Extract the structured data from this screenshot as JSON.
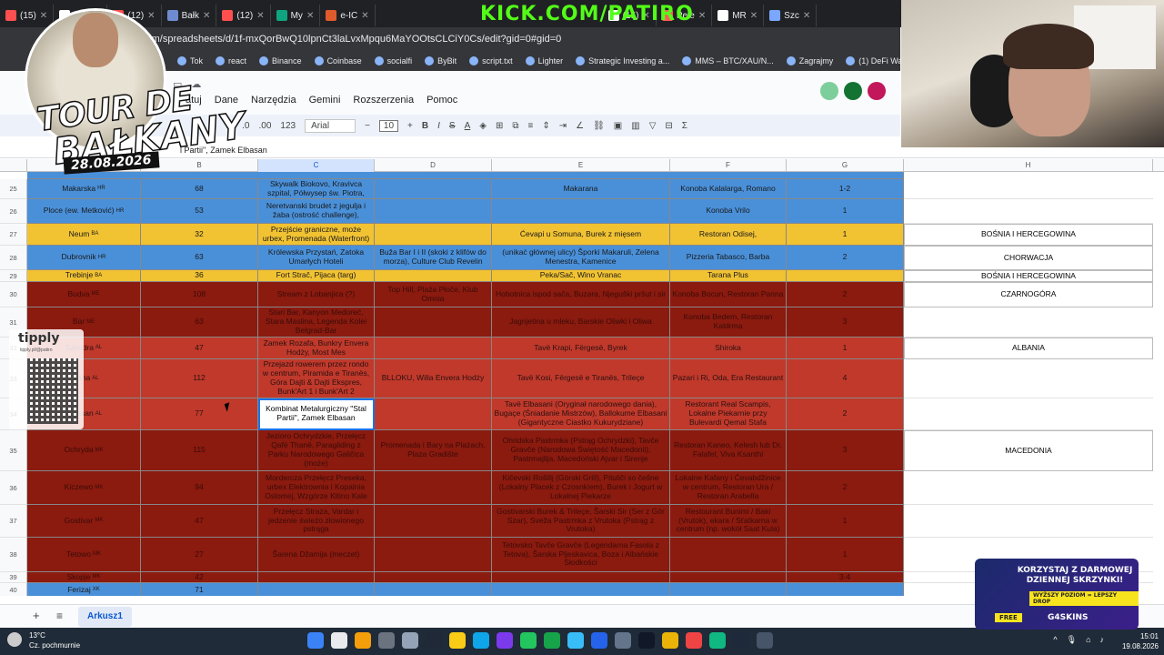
{
  "browser": {
    "tabs": [
      {
        "label": "(15)",
        "color": "#ff4f4f"
      },
      {
        "label": "(15)",
        "color": "#ffffff"
      },
      {
        "label": "(12)",
        "color": "#ff4f4f"
      },
      {
        "label": "Bałk",
        "color": "#6f8bd0"
      },
      {
        "label": "(12)",
        "color": "#ff4f4f"
      },
      {
        "label": "My",
        "color": "#10a37f"
      },
      {
        "label": "e-IC",
        "color": "#e05b2b"
      }
    ],
    "tabs_right": [
      {
        "label": "(15)",
        "color": "#ffffff"
      },
      {
        "label": "Pele",
        "color": "#ff5a5a"
      },
      {
        "label": "MR",
        "color": "#ffffff"
      },
      {
        "label": "Szc",
        "color": "#7aa7ff"
      }
    ],
    "kick_url": "KICK.COM/PATIRO",
    "url": "com/spreadsheets/d/1f-mxQorBwQ10lpnCt3laLvxMpqu6MaYOOtsCLCiY0Cs/edit?gid=0#gid=0",
    "bookmarks": [
      "Tok",
      "react",
      "Binance",
      "Coinbase",
      "socialfi",
      "ByBit",
      "script.txt",
      "Lighter",
      "Strategic Investing a...",
      "MMS – BTC/XAU/N...",
      "Zagrajmy",
      "(1) DeFi Warhol on...",
      "Patiro g"
    ]
  },
  "sheets": {
    "menu": [
      "atuj",
      "Dane",
      "Narzędzia",
      "Gemini",
      "Rozszerzenia",
      "Pomoc"
    ],
    "toolbar": {
      "font": "Arial",
      "size": "10",
      "items": [
        "zł",
        "%",
        ".0",
        ".00",
        "123"
      ]
    },
    "name_box": "C3",
    "formula": "l Partii\", Zamek Elbasan",
    "columns": [
      "B",
      "C",
      "D",
      "E",
      "F",
      "G",
      "H"
    ],
    "rows": [
      {
        "n": "25",
        "style": "blue",
        "a": "Makarska",
        "ac": "HR",
        "b": "68",
        "c": "Skywalk Biokovo, Kravivca szpital, Półwysep św. Piotra,",
        "d": "",
        "e": "Makarana",
        "f": "Konoba Kalalarga, Romano",
        "g": "1-2",
        "h": ""
      },
      {
        "n": "26",
        "style": "blue",
        "a": "Ploce (ew. Metković)",
        "ac": "HR",
        "b": "53",
        "c": "Neretvanski brudet z jegulja i žaba (ostrość challenge),",
        "d": "",
        "e": "",
        "f": "Konoba Vrilo",
        "g": "1",
        "h": ""
      },
      {
        "n": "27",
        "style": "yellow",
        "a": "Neum",
        "ac": "BA",
        "b": "32",
        "c": "Przejście graniczne, może urbex, Promenada (Waterfront)",
        "d": "",
        "e": "Ćevapi u Somuna, Burek z mięsem",
        "f": "Restoran Odisej,",
        "g": "1",
        "h": "BOŚNIA I HERCEGOWINA"
      },
      {
        "n": "28",
        "style": "blue",
        "a": "Dubrovnik",
        "ac": "HR",
        "b": "63",
        "c": "Królewska Przystań, Zatoka Umarłych Hoteli",
        "d": "Buža Bar I i II (skoki z klifów do morza), Culture Club Revelin",
        "e": "(unikać głównej ulicy) Šporki Makaruli, Zelena Menestra, Kamenice",
        "f": "Pizzeria Tabasco, Barba",
        "g": "2",
        "h": "CHORWACJA"
      },
      {
        "n": "29",
        "style": "yellow",
        "a": "Trebinje",
        "ac": "BA",
        "b": "36",
        "c": "Fort Strač, Pijaca (targ)",
        "d": "",
        "e": "Peka/Sač, Wino Vranac",
        "f": "Tarana Plus",
        "g": "",
        "h": "BOŚNIA I HERCEGOWINA"
      },
      {
        "n": "30",
        "style": "dred",
        "a": "Budva",
        "ac": "ME",
        "b": "108",
        "c": "Stream z Lobanjica (?)",
        "d": "Top Hill, Plaża Płoče, Klub Omnia",
        "e": "Hobotnica ispod sača, Buzara, Njeguški pršut i sir",
        "f": "Konoba Bocun, Restoran Panna",
        "g": "2",
        "h": "CZARNOGÓRA"
      },
      {
        "n": "31",
        "style": "dred",
        "a": "Bar",
        "ac": "ME",
        "b": "63",
        "c": "Stari Bar, Kanyon Medoreć, Stara Maslina, Legenda Kolei Belgrad-Bar",
        "d": "",
        "e": "Jagnjetina u mleku, Barskie Oliwki i Oliwa",
        "f": "Konoba Bedem, Restoran Kaldrma",
        "g": "3",
        "h": ""
      },
      {
        "n": "32",
        "style": "red",
        "a": "Szkodra",
        "ac": "AL",
        "b": "47",
        "c": "Zamek Rozafa, Bunkry Envera Hodży, Most Mes",
        "d": "",
        "e": "Tavë Krapi, Fërgesë, Byrek",
        "f": "Shiroka",
        "g": "1",
        "h": "ALBANIA"
      },
      {
        "n": "33",
        "style": "red",
        "a": "Tirana",
        "ac": "AL",
        "b": "112",
        "c": "Przejazd rowerem przez rondo w centrum, Piramida e Tiranës, Góra Dajti & Dajti Ekspres, Bunk'Art 1 i Bunk'Art 2",
        "d": "BLLOKU, Willa Envera Hodży",
        "e": "Tavë Kosi, Fërgesë e Tiranës, Trileçe",
        "f": "Pazari i Ri, Oda, Era Restaurant",
        "g": "4",
        "h": ""
      },
      {
        "n": "34",
        "style": "red",
        "a": "Elbasan",
        "ac": "AL",
        "b": "77",
        "c": "Kombinat Metalurgiczny \"Stal Partii\", Zamek Elbasan",
        "d": "",
        "e": "Tavë Elbasani (Oryginał narodowego dania), Bugaçe (Śniadanie Mistrzów), Ballokume Elbasani (Gigantyczne Ciastko Kukurydziane)",
        "f": "Restorant Real Scampis, Lokalne Piekarnie przy Bulevardi Qemal Stafa",
        "g": "2",
        "h": ""
      },
      {
        "n": "35",
        "style": "dred",
        "a": "Ochryda",
        "ac": "MK",
        "b": "115",
        "c": "Jezioro Ochrydzkie, Przełęcz Qafë Thanë, Paragliding z Parku Narodowego Galičica (może)",
        "d": "Promenada i Bary na Plażach, Plaza Gradište",
        "e": "Ohridska Pastrmka (Pstrąg Ochrydzki), Tavče Gravče (Narodowa Świętość Macedonii), Pastrmajlija, Macedoński Ajvar i Sirenje",
        "f": "Restoran Kaneo, Kelesh lub Dr. Falafel, Viva Ksanthi",
        "g": "3",
        "h": "MACEDONIA"
      },
      {
        "n": "36",
        "style": "dred",
        "a": "Kiczewo",
        "ac": "MK",
        "b": "94",
        "c": "Mordercza Przełęcz Preseka, urbex Elektrownia i Kopalnia Oslomej, Wzgórze Kitino Kale",
        "d": "",
        "e": "Kičevski Rošlilj (Górski Grill), Pituliči so češne (Lokalny Placek z Czosnkiem), Burek i Jogurt w Lokalnej Piekarze",
        "f": "Lokalne Kafany i Ćevabdžinice w centrum, Restoran Ura / Restoran Arabella",
        "g": "2",
        "h": ""
      },
      {
        "n": "37",
        "style": "dred",
        "a": "Gostivar",
        "ac": "MK",
        "b": "47",
        "c": "Przełęcz Straza, Vardar i jedzenie świeżo złowionego pstrąga",
        "d": "",
        "e": "Gostivarski Burek & Trileçe, Šarski Sir (Ser z Gór Szar), Sveža Pastrmka z Vrutoka (Pstrąg z Vrutoka)",
        "f": "Restourant Bunimi / Baki (Vrutok), ekara / Sťatkarna w centrum (np. wokół Saat Kula)",
        "g": "1",
        "h": ""
      },
      {
        "n": "38",
        "style": "dred",
        "a": "Tetowo",
        "ac": "MK",
        "b": "27",
        "c": "Šarena Džamija (meczet)",
        "d": "",
        "e": "Tetovsko Tavče Gravče (Legendarna Fasola z Tetova), Šarska Pljeskavica, Boza i Albańskie Słodkości",
        "f": "",
        "g": "1",
        "h": ""
      },
      {
        "n": "39",
        "style": "dred",
        "a": "Skopje",
        "ac": "MK",
        "b": "42",
        "c": "",
        "d": "",
        "e": "",
        "f": "",
        "g": "3-4",
        "h": ""
      },
      {
        "n": "40",
        "style": "blue",
        "a": "Ferizaj",
        "ac": "XK",
        "b": "71",
        "c": "",
        "d": "",
        "e": "",
        "f": "",
        "g": "",
        "h": ""
      }
    ],
    "sheet_tab": "Arkusz1"
  },
  "overlay": {
    "title1": "TOUR DE",
    "title2": "BAŁKANY",
    "date": "28.08.2026"
  },
  "tipply": {
    "name": "tipply",
    "url": "tipply.pl/@patiro"
  },
  "promo": {
    "line1": "KORZYSTAJ Z DARMOWEJ DZIENNEJ SKRZYNKI!",
    "line2": "WYŻSZY POZIOM = LEPSZY DROP",
    "free": "FREE",
    "brand": "G4SKINS"
  },
  "taskbar": {
    "temp": "13°C",
    "weather": "Cz. pochmurnie",
    "time": "15:01",
    "date": "19.08.2026"
  }
}
